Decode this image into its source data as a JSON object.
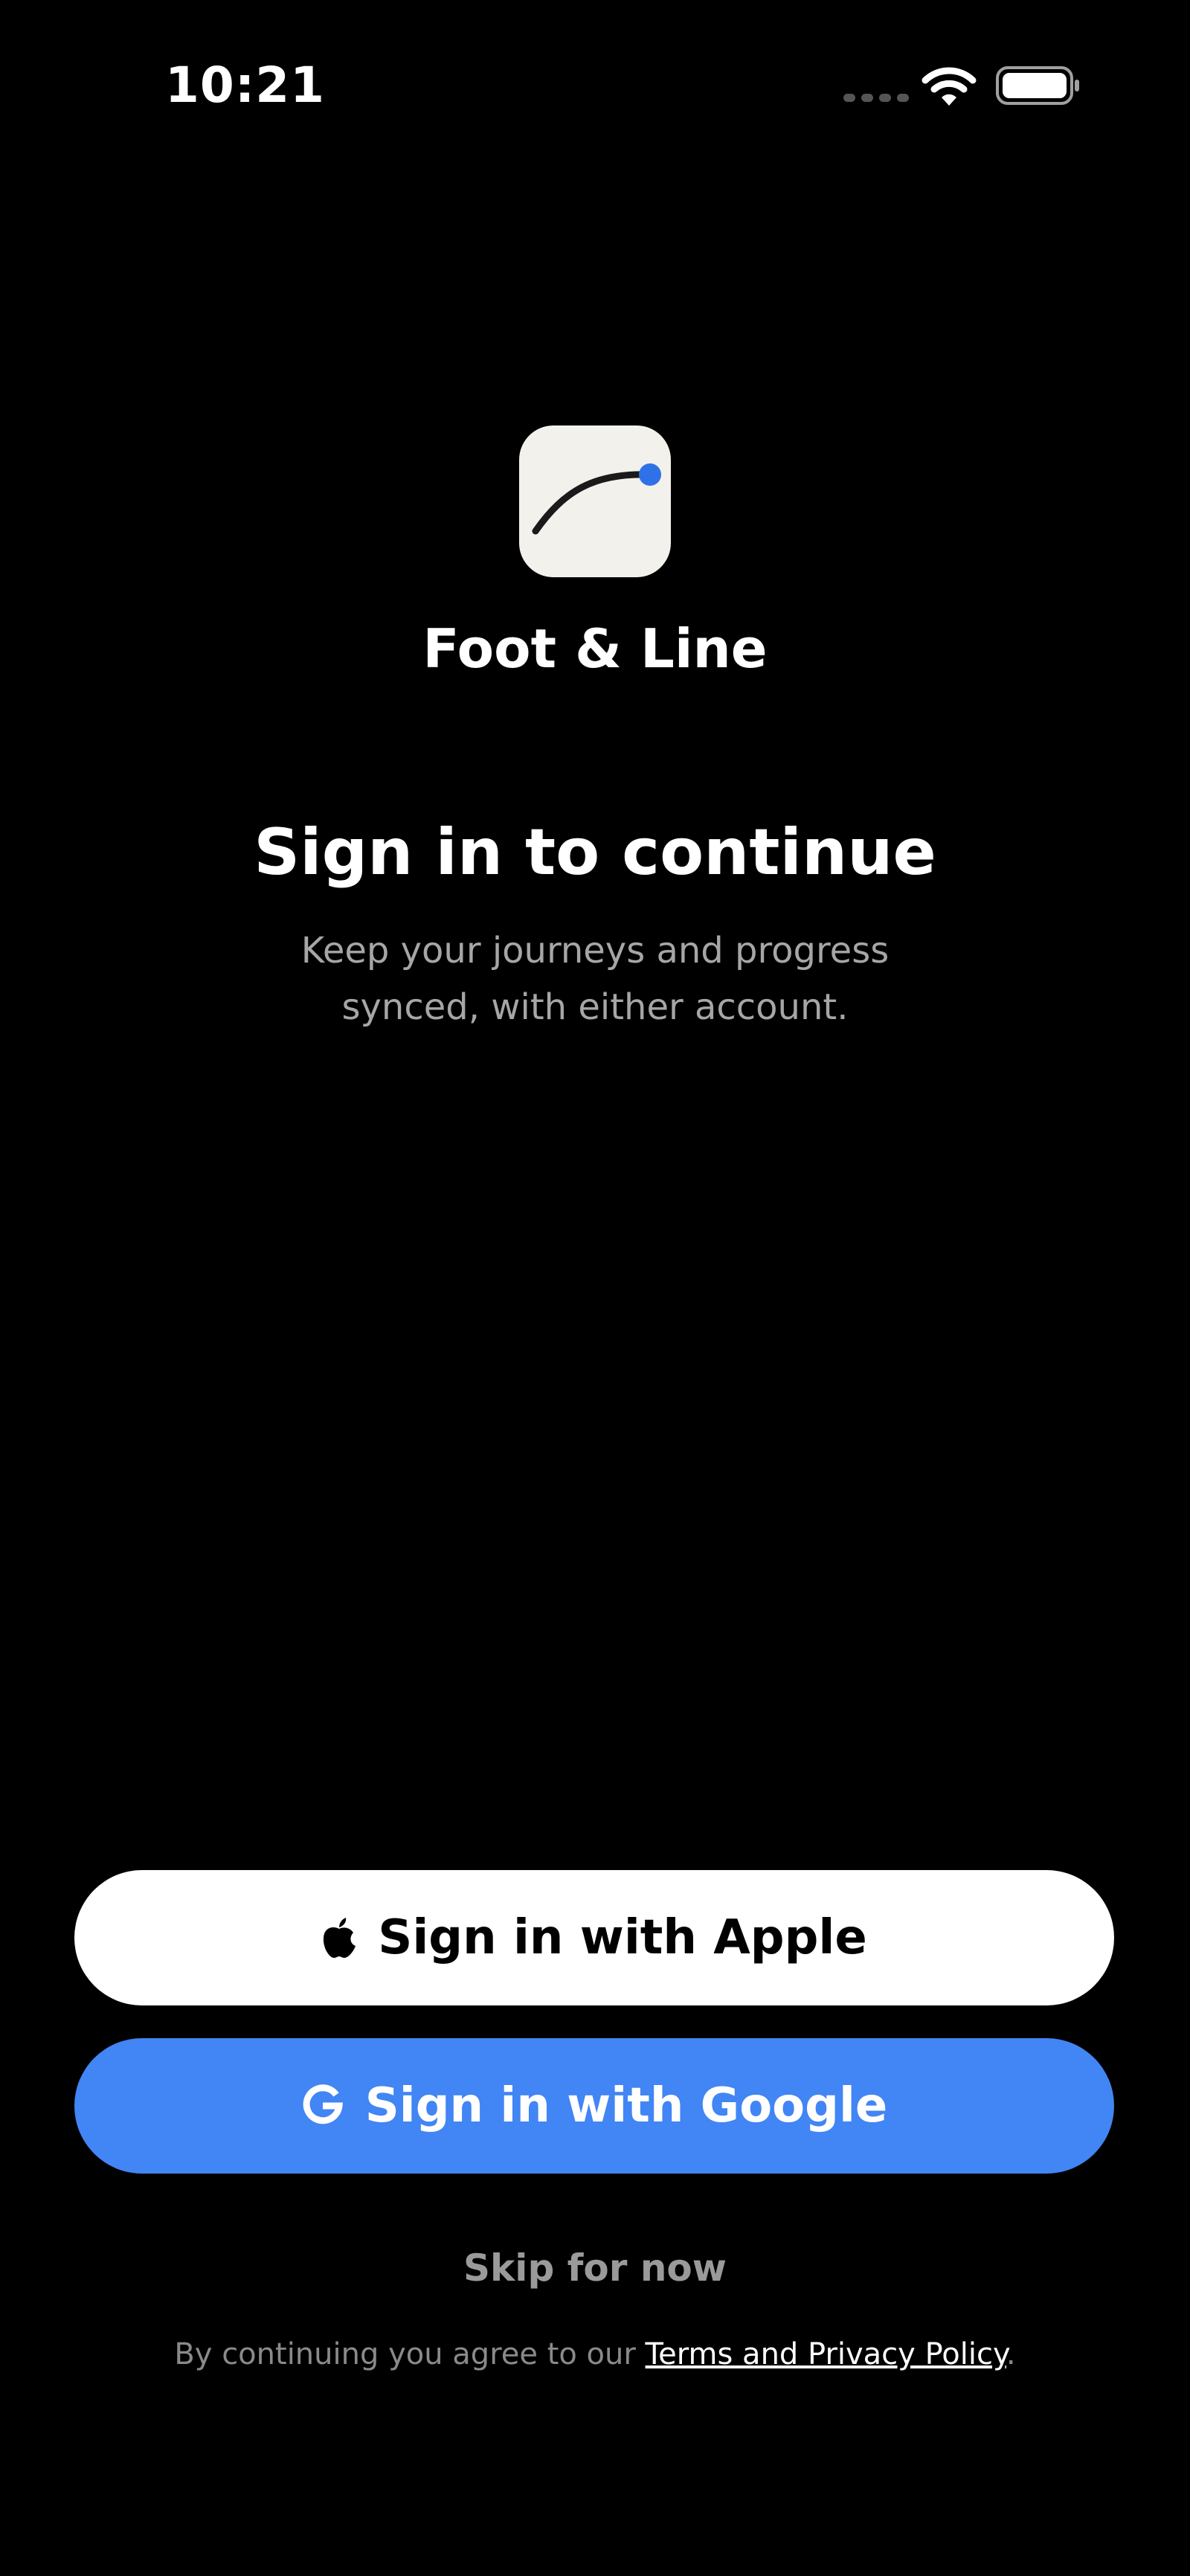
{
  "status_bar": {
    "time": "10:21",
    "icons": [
      "cellular-signal-icon",
      "wifi-icon",
      "battery-icon"
    ]
  },
  "app": {
    "name": "Foot & Line",
    "icon": "curve-line-logo-icon",
    "icon_background": "#f3f1ec",
    "icon_accent": "#2f72e8"
  },
  "heading": {
    "title": "Sign in to continue",
    "subtitle": "Keep your journeys and progress synced, with either account."
  },
  "actions": {
    "apple_label": "Sign in with Apple",
    "apple_icon": "apple-logo-icon",
    "google_label": "Sign in with Google",
    "google_icon": "google-g-icon",
    "skip_label": "Skip for now"
  },
  "legal": {
    "prefix": "By continuing you agree to our ",
    "link_text": "Terms and Privacy Policy",
    "suffix": "."
  },
  "colors": {
    "background": "#000000",
    "google_blue": "#4285f4",
    "apple_white": "#ffffff",
    "muted_text": "#a6a6a6"
  }
}
